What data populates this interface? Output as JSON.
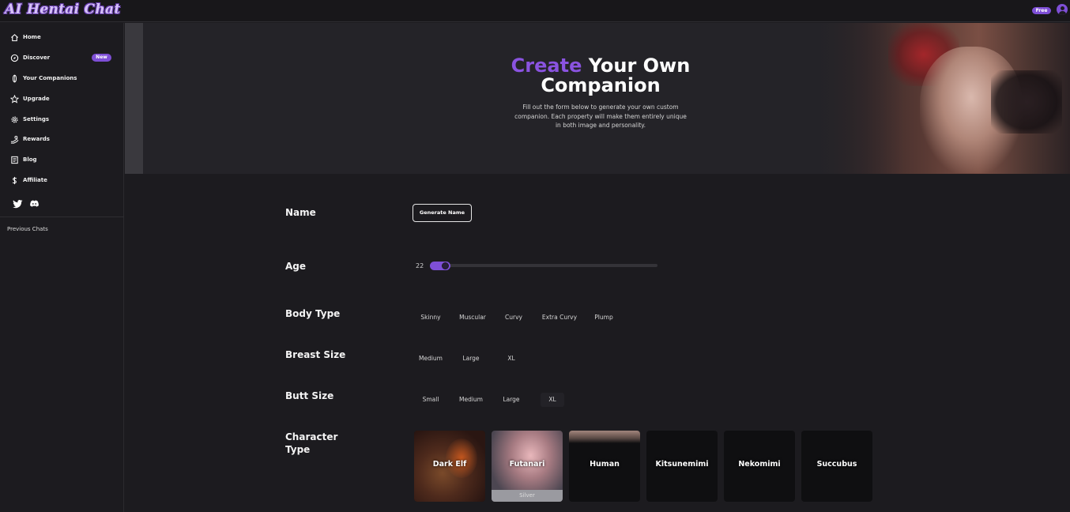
{
  "header": {
    "logo_text": "AI Hentai Chat",
    "plan_badge": "Free",
    "accent_color": "#7e4fd6"
  },
  "sidebar": {
    "items": [
      {
        "label": "Home",
        "icon": "home-icon"
      },
      {
        "label": "Discover",
        "icon": "compass-icon",
        "badge": "New"
      },
      {
        "label": "Your Companions",
        "icon": "companion-icon"
      },
      {
        "label": "Upgrade",
        "icon": "star-icon"
      },
      {
        "label": "Settings",
        "icon": "gear-icon"
      },
      {
        "label": "Rewards",
        "icon": "rewards-icon"
      },
      {
        "label": "Blog",
        "icon": "blog-icon"
      },
      {
        "label": "Affiliate",
        "icon": "dollar-icon"
      }
    ],
    "social": [
      "twitter-icon",
      "discord-icon"
    ],
    "previous_chats_label": "Previous Chats"
  },
  "hero": {
    "title_accent": "Create",
    "title_rest_line1": "Your Own",
    "title_line2": "Companion",
    "subtitle": "Fill out the form below to generate your own custom companion. Each property will make them entirely unique in both image and personality."
  },
  "form": {
    "name": {
      "label": "Name",
      "button": "Generate Name"
    },
    "age": {
      "label": "Age",
      "value": "22"
    },
    "body_type": {
      "label": "Body Type",
      "options": [
        "Skinny",
        "Muscular",
        "Curvy",
        "Extra Curvy",
        "Plump"
      ]
    },
    "breast_size": {
      "label": "Breast Size",
      "options": [
        "Medium",
        "Large",
        "XL"
      ]
    },
    "butt_size": {
      "label": "Butt Size",
      "options": [
        "Small",
        "Medium",
        "Large",
        "XL"
      ]
    },
    "character_type": {
      "label_line1": "Character",
      "label_line2": "Type",
      "cards": [
        {
          "name": "Dark Elf"
        },
        {
          "name": "Futanari",
          "tier": "Silver"
        },
        {
          "name": "Human"
        },
        {
          "name": "Kitsunemimi"
        },
        {
          "name": "Nekomimi"
        },
        {
          "name": "Succubus"
        }
      ]
    }
  }
}
